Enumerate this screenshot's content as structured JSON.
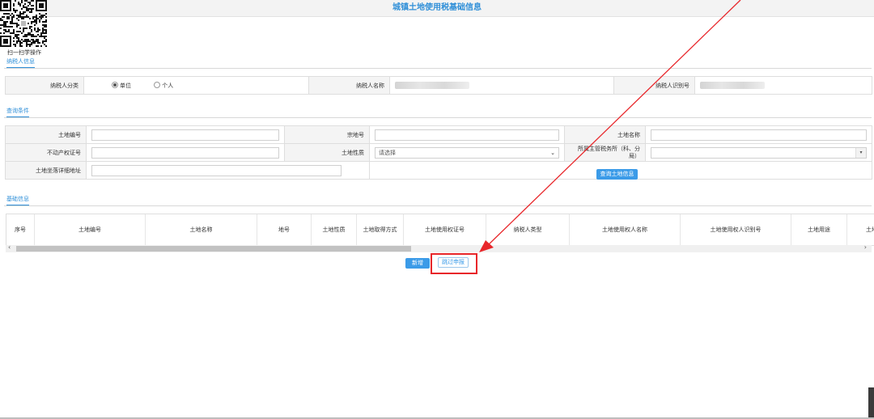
{
  "page": {
    "title": "城镇土地使用税基础信息"
  },
  "qr": {
    "caption": "扫一扫学操作"
  },
  "taxpayer_section": {
    "title": "纳税人信息",
    "type_label": "纳税人分类",
    "type_options": [
      {
        "label": "单位",
        "selected": true
      },
      {
        "label": "个人",
        "selected": false
      }
    ],
    "name_label": "纳税人名称",
    "id_label": "纳税人识别号"
  },
  "query_section": {
    "title": "查询条件",
    "land_no_label": "土地编号",
    "parcel_no_label": "宗地号",
    "land_name_label": "土地名称",
    "property_cert_label": "不动产权证号",
    "land_nature_label": "土地性质",
    "land_nature_placeholder": "请选择",
    "tax_office_label": "所属主管税务所（科、分局）",
    "address_label": "土地坐落详细地址",
    "query_button": "查询土地信息"
  },
  "basic_section": {
    "title": "基础信息",
    "columns": [
      "序号",
      "土地编号",
      "土地名称",
      "地号",
      "土地性质",
      "土地取得方式",
      "土地使用权证号",
      "纳税人类型",
      "土地使用权人名称",
      "土地使用权人识别号",
      "土地用途",
      "土地"
    ]
  },
  "actions": {
    "add_button": "新增",
    "skip_button": "跳过申报"
  },
  "colors": {
    "accent": "#3b9be8",
    "highlight": "#e8262a"
  }
}
